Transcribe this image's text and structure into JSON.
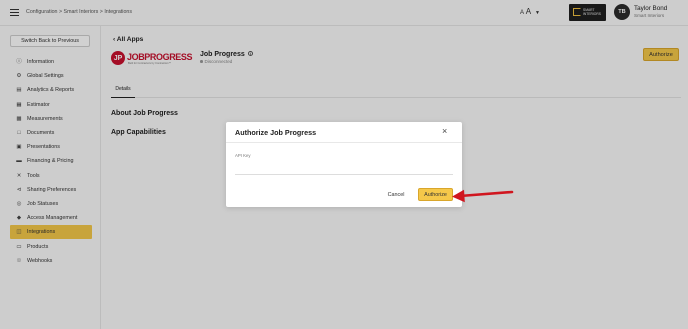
{
  "topbar": {
    "breadcrumb": "Configuration > Smart Interiors > Integrations",
    "font_size_small": "A",
    "font_size_large": "A",
    "logo_text_line1": "SMART",
    "logo_text_line2": "INTERIORS",
    "avatar_initials": "TB",
    "user_name": "Taylor Bond",
    "user_company": "Smart Interiors"
  },
  "sidebar": {
    "switch_label": "Switch Back to Previous",
    "items": [
      {
        "label": "Information",
        "icon": "info-icon"
      },
      {
        "label": "Global Settings",
        "icon": "gear-icon"
      },
      {
        "label": "Analytics & Reports",
        "icon": "chart-icon"
      },
      {
        "label": "Estimator",
        "icon": "calculator-icon"
      },
      {
        "label": "Measurements",
        "icon": "ruler-icon"
      },
      {
        "label": "Documents",
        "icon": "document-icon"
      },
      {
        "label": "Presentations",
        "icon": "presentation-icon"
      },
      {
        "label": "Financing & Pricing",
        "icon": "wallet-icon"
      },
      {
        "label": "Tools",
        "icon": "tools-icon"
      },
      {
        "label": "Sharing Preferences",
        "icon": "share-icon"
      },
      {
        "label": "Job Statuses",
        "icon": "status-icon"
      },
      {
        "label": "Access Management",
        "icon": "lock-icon"
      },
      {
        "label": "Integrations",
        "icon": "integrations-icon"
      },
      {
        "label": "Products",
        "icon": "box-icon"
      },
      {
        "label": "Webhooks",
        "icon": "webhook-icon"
      }
    ],
    "active_item": "Integrations"
  },
  "main": {
    "back_label": "All Apps",
    "logo_word": "JOBPROGRESS",
    "logo_letter": "JP",
    "logo_tagline": "Built for Contractors by Contractors™",
    "app_name": "Job Progress",
    "status": "Disconnected",
    "authorize_label": "Authorize",
    "tab_details": "Details",
    "section_about": "About Job Progress",
    "section_capabilities": "App Capabilities"
  },
  "modal": {
    "title": "Authorize Job Progress",
    "close_symbol": "×",
    "api_label": "API Key",
    "api_value": "",
    "api_placeholder": "",
    "cancel_label": "Cancel",
    "authorize_label": "Authorize"
  },
  "colors": {
    "accent": "#f5c84a",
    "brand_red": "#c8102e",
    "arrow": "#d0161f"
  }
}
